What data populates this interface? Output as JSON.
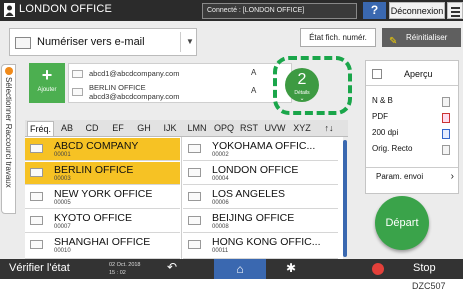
{
  "header": {
    "title": "LONDON OFFICE",
    "status": "Connecté : [LONDON OFFICE]",
    "help_label": "?",
    "logout_label": "Déconnexion"
  },
  "function_select": {
    "label": "Numériser vers e-mail"
  },
  "toolbar": {
    "file_status_label": "État fich. numér.",
    "reset_label": "Réinitialiser"
  },
  "side_tab": {
    "label": "Sélectionner Raccourci travaux"
  },
  "add_button": {
    "label": "Ajouter"
  },
  "destinations": [
    {
      "line1": "abcd1@abcdcompany.com",
      "line2": "",
      "badge": "A"
    },
    {
      "line1": "BERLIN OFFICE",
      "line2": "abcd3@abcdcompany.com",
      "badge": "A"
    }
  ],
  "destination_count": {
    "value": "2",
    "label": "Détails"
  },
  "index_tabs": [
    "Fréq.",
    "AB",
    "CD",
    "EF",
    "GH",
    "IJK",
    "LMN",
    "OPQ",
    "RST",
    "UVW",
    "XYZ"
  ],
  "active_tab": "Fréq.",
  "address_list": [
    {
      "name": "ABCD COMPANY",
      "number": "00001",
      "selected": true
    },
    {
      "name": "YOKOHAMA OFFIC...",
      "number": "00002",
      "selected": false
    },
    {
      "name": "BERLIN OFFICE",
      "number": "00003",
      "selected": true
    },
    {
      "name": "LONDON OFFICE",
      "number": "00004",
      "selected": false
    },
    {
      "name": "NEW YORK OFFICE",
      "number": "00005",
      "selected": false
    },
    {
      "name": "LOS ANGELES",
      "number": "00006",
      "selected": false
    },
    {
      "name": "KYOTO OFFICE",
      "number": "00007",
      "selected": false
    },
    {
      "name": "BEIJING OFFICE",
      "number": "00008",
      "selected": false
    },
    {
      "name": "SHANGHAI  OFFICE",
      "number": "00010",
      "selected": false
    },
    {
      "name": "HONG KONG OFFIC...",
      "number": "00011",
      "selected": false
    }
  ],
  "settings": {
    "preview_label": "Aperçu",
    "color": "N & B",
    "file_type": "PDF",
    "resolution": "200 dpi",
    "orientation": "Orig. Recto",
    "send_settings_label": "Param. envoi"
  },
  "start_button": {
    "label": "Départ"
  },
  "bottom_bar": {
    "check_status_label": "Vérifier l'état",
    "date": "02 Oct. 2018",
    "time": "15 : 02",
    "stop_label": "Stop"
  },
  "image_code": "DZC507",
  "colors": {
    "selected_row": "#f6c224",
    "accent_green": "#3aa34a",
    "accent_blue": "#3a68b0",
    "highlight": "#1aa64a"
  }
}
